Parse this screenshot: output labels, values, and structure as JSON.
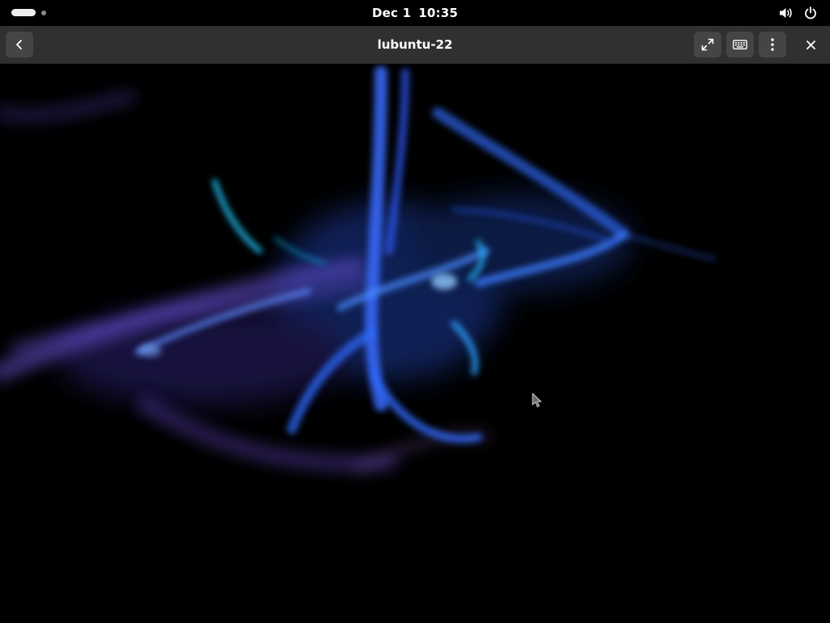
{
  "topbar": {
    "date": "Dec 1",
    "time": "10:35",
    "icons": {
      "volume": "volume-icon",
      "power": "power-icon"
    }
  },
  "headerbar": {
    "title": "lubuntu-22",
    "icons": {
      "back": "back-chevron-icon",
      "fullscreen": "fullscreen-icon",
      "keyboard": "keyboard-icon",
      "menu": "vertical-dots-menu-icon",
      "close": "close-icon"
    }
  },
  "colors": {
    "topbar_bg": "#000000",
    "headerbar_bg": "#303030",
    "button_bg": "#454545",
    "wallpaper_accent": "#2f6bff",
    "wallpaper_secondary": "#7a5cff",
    "wallpaper_cyan": "#1ec8ff"
  }
}
